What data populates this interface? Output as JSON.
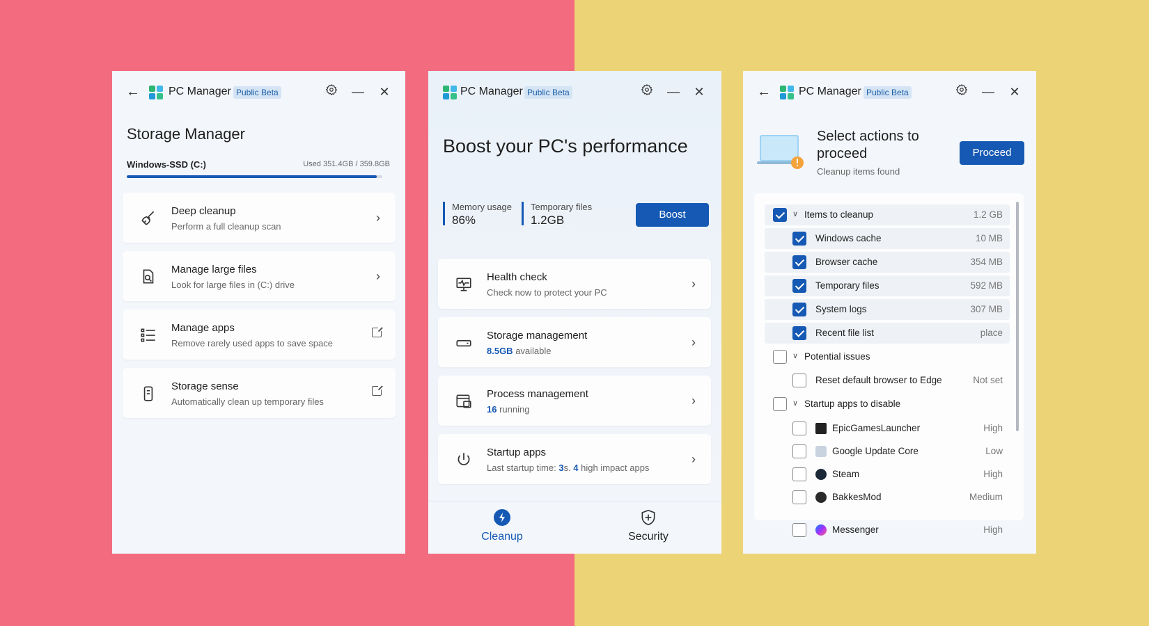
{
  "colors": {
    "bg_left": "#f26b7f",
    "bg_right": "#ecd376",
    "accent": "#1559b4"
  },
  "app": {
    "title": "PC Manager",
    "badge": "Public Beta"
  },
  "storage": {
    "heading": "Storage Manager",
    "drive_name": "Windows-SSD (C:)",
    "drive_used": "Used 351.4GB / 359.8GB",
    "drive_fill_percent": 97.7,
    "cards": [
      {
        "title": "Deep cleanup",
        "subtitle": "Perform a full cleanup scan",
        "icon": "broom-icon"
      },
      {
        "title": "Manage large files",
        "subtitle": "Look for large files in (C:) drive",
        "icon": "file-search-icon"
      },
      {
        "title": "Manage apps",
        "subtitle": "Remove rarely used apps to save space",
        "icon": "apps-list-icon"
      },
      {
        "title": "Storage sense",
        "subtitle": "Automatically clean up temporary files",
        "icon": "phone-storage-icon"
      }
    ]
  },
  "boost": {
    "heading": "Boost your PC's performance",
    "memory_label": "Memory usage",
    "memory_value": "86%",
    "temp_label": "Temporary files",
    "temp_value": "1.2GB",
    "boost_button": "Boost",
    "cards": [
      {
        "title": "Health check",
        "subtitle": "Check now to protect your PC"
      },
      {
        "title": "Storage management",
        "sub_strong": "8.5GB",
        "sub_rest": " available"
      },
      {
        "title": "Process management",
        "sub_strong": "16",
        "sub_rest": " running"
      },
      {
        "title": "Startup apps",
        "sub_pre": "Last startup time: ",
        "sub_a": "3",
        "sub_mid": "s. ",
        "sub_b": "4",
        "sub_post": " high impact apps"
      }
    ],
    "nav": {
      "cleanup": "Cleanup",
      "security": "Security"
    }
  },
  "cleanup": {
    "heading": "Select actions to proceed",
    "subtitle": "Cleanup items found",
    "proceed_button": "Proceed",
    "groups": [
      {
        "label": "Items to cleanup",
        "value": "1.2 GB"
      },
      {
        "label": "Potential issues",
        "value": ""
      },
      {
        "label": "Startup apps to disable",
        "value": ""
      }
    ],
    "items": [
      {
        "label": "Windows cache",
        "value": "10 MB"
      },
      {
        "label": "Browser cache",
        "value": "354 MB"
      },
      {
        "label": "Temporary files",
        "value": "592 MB"
      },
      {
        "label": "System logs",
        "value": "307 MB"
      },
      {
        "label": "Recent file list",
        "value": "place"
      }
    ],
    "issues": [
      {
        "label": "Reset default browser to Edge",
        "value": "Not set"
      }
    ],
    "startup": [
      {
        "label": "EpicGamesLauncher",
        "value": "High"
      },
      {
        "label": "Google Update Core",
        "value": "Low"
      },
      {
        "label": "Steam",
        "value": "High"
      },
      {
        "label": "BakkesMod",
        "value": "Medium"
      },
      {
        "label": "Messenger",
        "value": "High"
      }
    ]
  }
}
